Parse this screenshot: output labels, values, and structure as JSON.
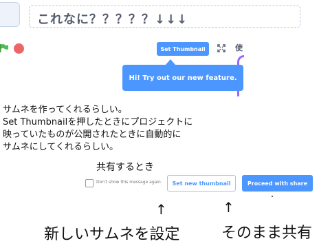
{
  "project": {
    "title": "これなに？？？？？↓↓↓"
  },
  "controls": {
    "set_thumbnail_label": "Set Thumbnail",
    "tab_glyph": "使"
  },
  "tooltip": {
    "text": "Hi! Try out our new feature."
  },
  "notes": {
    "line1": "サムネを作ってくれるらしい。",
    "line2": "Set Thumbnailを押したときにプロジェクトに",
    "line3": "映っていたものが公開されたときに自動的に",
    "line4": "サムネにしてくれるらしい。",
    "share_heading": "共有するとき"
  },
  "dialog": {
    "dont_show_label": "Don't show this message again",
    "set_new_thumbnail_label": "Set new thumbnail",
    "proceed_label": "Proceed with share"
  },
  "annotations": {
    "arrow": "↑",
    "left_label": "新しいサムネを設定",
    "right_label": "そのまま共有"
  },
  "colors": {
    "accent": "#4c97ff",
    "stop": "#ec6666",
    "flag": "#4cbf56",
    "extension": "#9966ff"
  }
}
